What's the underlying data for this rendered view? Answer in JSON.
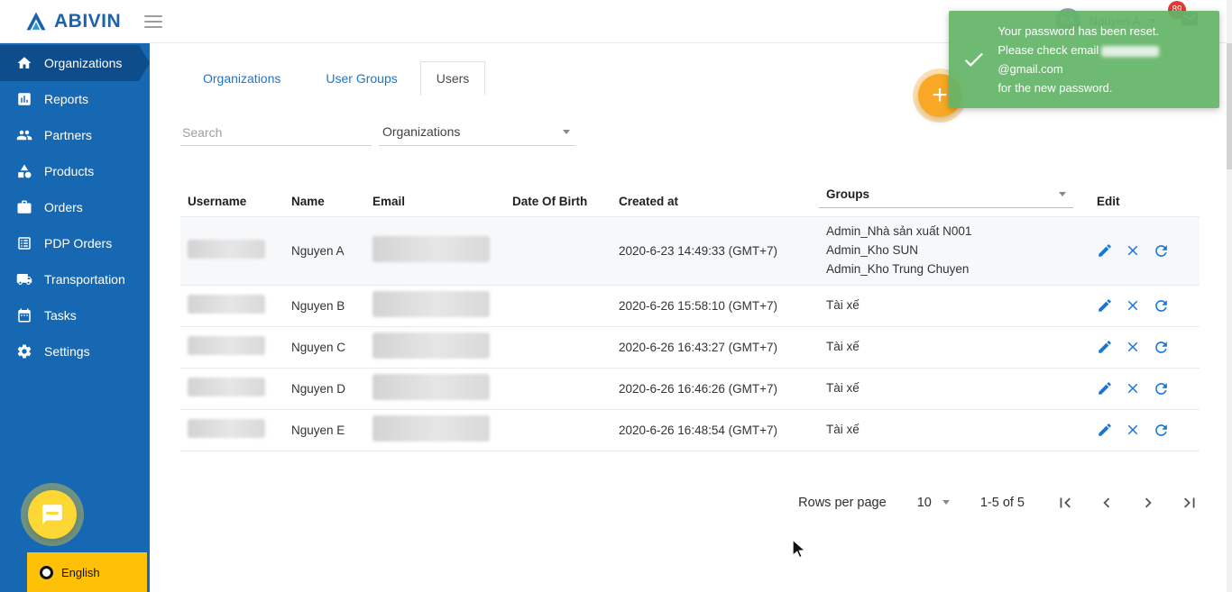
{
  "colors": {
    "sidebar_blue": "#1768b3",
    "sidebar_active": "#0e4d8c",
    "accent_blue": "#1976d2",
    "toast_green": "#63b467",
    "fab_orange": "#f9a825",
    "chat_yellow": "#fdd835",
    "lang_yellow": "#ffc107",
    "badge_red": "#e53935",
    "logo_blue": "#1b63ac"
  },
  "brand": {
    "name": "ABIVIN"
  },
  "header": {
    "user_initials": "NA",
    "user_name": "Nguyen A",
    "badge_count": "89"
  },
  "toast": {
    "line1": "Your password has been reset.",
    "line2_prefix": "Please check email",
    "line2_suffix": "@gmail.com",
    "line3": "for the new password."
  },
  "sidebar": {
    "items": [
      {
        "label": "Organizations",
        "icon": "home-icon",
        "active": true
      },
      {
        "label": "Reports",
        "icon": "bar-chart-icon"
      },
      {
        "label": "Partners",
        "icon": "people-icon"
      },
      {
        "label": "Products",
        "icon": "category-icon"
      },
      {
        "label": "Orders",
        "icon": "briefcase-icon"
      },
      {
        "label": "PDP Orders",
        "icon": "list-icon"
      },
      {
        "label": "Transportation",
        "icon": "truck-icon"
      },
      {
        "label": "Tasks",
        "icon": "calendar-icon"
      },
      {
        "label": "Settings",
        "icon": "gear-icon"
      }
    ]
  },
  "main": {
    "tabs": [
      {
        "label": "Organizations"
      },
      {
        "label": "User Groups"
      },
      {
        "label": "Users",
        "active": true
      }
    ],
    "search_placeholder": "Search",
    "filter_label": "Organizations",
    "table": {
      "headers": [
        "Username",
        "Name",
        "Email",
        "Date Of Birth",
        "Created at",
        "Groups",
        "Edit"
      ],
      "rows": [
        {
          "name": "Nguyen A",
          "created_at": "2020-6-23 14:49:33 (GMT+7)",
          "groups": [
            "Admin_Nhà sản xuất N001",
            "Admin_Kho SUN",
            "Admin_Kho Trung Chuyen"
          ]
        },
        {
          "name": "Nguyen B",
          "created_at": "2020-6-26 15:58:10 (GMT+7)",
          "groups": [
            "Tài xế"
          ]
        },
        {
          "name": "Nguyen C",
          "created_at": "2020-6-26 16:43:27 (GMT+7)",
          "groups": [
            "Tài xế"
          ]
        },
        {
          "name": "Nguyen D",
          "created_at": "2020-6-26 16:46:26 (GMT+7)",
          "groups": [
            "Tài xế"
          ]
        },
        {
          "name": "Nguyen E",
          "created_at": "2020-6-26 16:48:54 (GMT+7)",
          "groups": [
            "Tài xế"
          ]
        }
      ]
    },
    "pagination": {
      "rows_per_page_label": "Rows per page",
      "rows_per_page_value": "10",
      "range": "1-5 of 5"
    }
  },
  "language": {
    "label": "English"
  }
}
